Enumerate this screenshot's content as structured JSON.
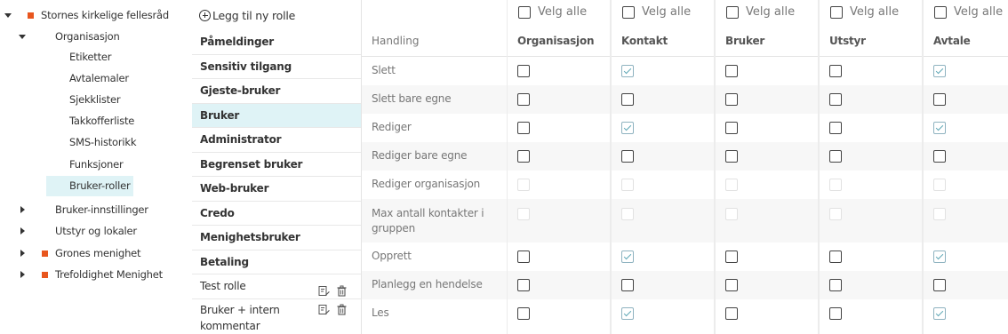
{
  "tree": {
    "root": "Stornes kirkelige fellesråd",
    "org": "Organisasjon",
    "items": [
      "Etiketter",
      "Avtalemaler",
      "Sjekklister",
      "Takkofferliste",
      "SMS-historikk",
      "Funksjoner",
      "Bruker-roller"
    ],
    "selected": "Bruker-roller",
    "after": [
      "Bruker-innstillinger",
      "Utstyr og lokaler"
    ],
    "congregations": [
      "Grones menighet",
      "Trefoldighet Menighet"
    ],
    "accent": "#e8561e"
  },
  "roles": {
    "add_label": "Legg til ny rolle",
    "list": [
      {
        "label": "Påmeldinger",
        "custom": false
      },
      {
        "label": "Sensitiv tilgang",
        "custom": false
      },
      {
        "label": "Gjeste-bruker",
        "custom": false
      },
      {
        "label": "Bruker",
        "custom": false,
        "selected": true
      },
      {
        "label": "Administrator",
        "custom": false
      },
      {
        "label": "Begrenset bruker",
        "custom": false
      },
      {
        "label": "Web-bruker",
        "custom": false
      },
      {
        "label": "Credo",
        "custom": false
      },
      {
        "label": "Menighetsbruker",
        "custom": false
      },
      {
        "label": "Betaling",
        "custom": false
      },
      {
        "label": "Test rolle",
        "custom": true
      },
      {
        "label": "Bruker + intern kommentar",
        "custom": true
      }
    ]
  },
  "grid": {
    "action_header": "Handling",
    "select_all": "Velg alle",
    "columns": [
      "Organisasjon",
      "Kontakt",
      "Bruker",
      "Utstyr",
      "Avtale"
    ],
    "rows": [
      {
        "label": "Slett",
        "values": [
          0,
          1,
          0,
          0,
          1
        ]
      },
      {
        "label": "Slett bare egne",
        "values": [
          0,
          0,
          0,
          0,
          0
        ]
      },
      {
        "label": "Rediger",
        "values": [
          0,
          1,
          0,
          0,
          1
        ]
      },
      {
        "label": "Rediger bare egne",
        "values": [
          0,
          0,
          0,
          0,
          0
        ]
      },
      {
        "label": "Rediger organisasjon",
        "values": [
          -1,
          -1,
          -1,
          -1,
          -1
        ]
      },
      {
        "label": "Max antall kontakter i gruppen",
        "values": [
          -1,
          -1,
          -1,
          -1,
          -1
        ]
      },
      {
        "label": "Opprett",
        "values": [
          0,
          1,
          0,
          0,
          1
        ]
      },
      {
        "label": "Planlegg en hendelse",
        "values": [
          0,
          0,
          0,
          0,
          0
        ]
      },
      {
        "label": "Les",
        "values": [
          0,
          1,
          0,
          0,
          1
        ]
      }
    ]
  }
}
